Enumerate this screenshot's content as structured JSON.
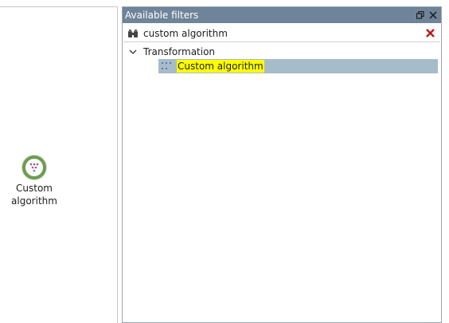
{
  "canvas": {
    "node": {
      "label_line1": "Custom",
      "label_line2": "algorithm"
    }
  },
  "filters_panel": {
    "title": "Available filters",
    "search": {
      "value": "custom algorithm"
    },
    "tree": {
      "category": "Transformation",
      "items": [
        {
          "label": "Custom algorithm",
          "highlight": "Custom algorithm",
          "selected": true
        }
      ]
    }
  },
  "colors": {
    "header_bg": "#6f8499",
    "selection_bg": "#a7bccb",
    "match_highlight": "#ffff00",
    "node_ring": "#6e9c52",
    "clear_icon": "#d42a2a"
  },
  "icons": [
    "restore-icon",
    "close-icon",
    "binoculars-icon",
    "clear-search-icon",
    "chevron-down-icon",
    "filter-icon"
  ]
}
